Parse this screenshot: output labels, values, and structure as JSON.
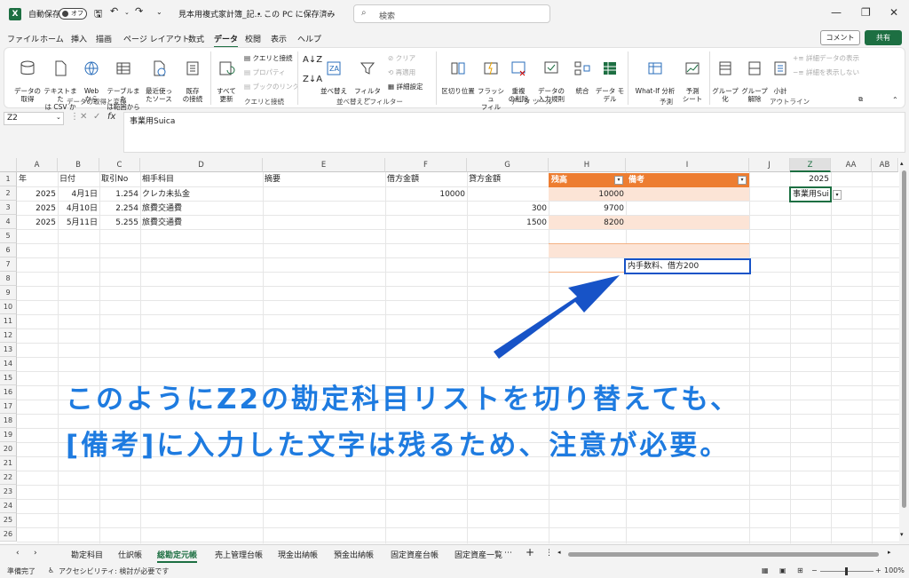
{
  "titlebar": {
    "autosave": "自動保存",
    "autosave_state": "オフ",
    "filename": "見本用複式家計簿_記…",
    "location": "• この PC に保存済み",
    "search_placeholder": "検索"
  },
  "menu": [
    "ファイル",
    "ホーム",
    "挿入",
    "描画",
    "ページ レイアウト",
    "数式",
    "データ",
    "校閲",
    "表示",
    "ヘルプ"
  ],
  "menu_active": "データ",
  "comment_label": "コメント",
  "share_label": "共有",
  "ribbon": {
    "get_data": "データの\n取得",
    "text_csv": "テキストまた\nは CSV から",
    "web": "Web\nから",
    "table_range": "テーブルまた\nは範囲から",
    "recent": "最近使っ\nたソース",
    "existing": "既存\nの接続",
    "group1": "データの取得と変換",
    "refresh_all": "すべて\n更新",
    "queries": "クエリと接続",
    "properties": "プロパティ",
    "edit_links": "ブックのリンク",
    "group2": "クエリと接続",
    "sort": "並べ替え",
    "filter": "フィルター",
    "clear": "クリア",
    "reapply": "再適用",
    "advanced": "詳細設定",
    "group3": "並べ替えとフィルター",
    "text_to_cols": "区切り位置",
    "flash_fill": "フラッシュ\nフィル",
    "remove_dup": "重複\nの削除",
    "validation": "データの\n入力規則",
    "consolidate": "統合",
    "data_model": "データ モ\nデル",
    "group4": "データ ツール",
    "whatif": "What-If 分析",
    "forecast": "予測\nシート",
    "group5": "予測",
    "group_btn": "グループ\n化",
    "ungroup": "グループ\n解除",
    "subtotal": "小計",
    "show_detail": "詳細データの表示",
    "hide_detail": "詳細を表示しない",
    "group6": "アウトライン"
  },
  "namebox": "Z2",
  "formula": "事業用Suica",
  "columns": [
    "A",
    "B",
    "C",
    "D",
    "E",
    "F",
    "G",
    "H",
    "I",
    "J",
    "Z",
    "AA",
    "AB"
  ],
  "rows": [
    "1",
    "2",
    "3",
    "4",
    "5",
    "6",
    "7",
    "8",
    "9",
    "10",
    "11",
    "12",
    "13",
    "14",
    "15",
    "16",
    "17",
    "18",
    "19",
    "20",
    "21",
    "22",
    "23",
    "24",
    "25",
    "26"
  ],
  "header_row": {
    "a": "年",
    "b": "日付",
    "c": "取引No",
    "d": "相手科目",
    "e": "摘要",
    "f": "借方金額",
    "g": "貸方金額",
    "h": "残高",
    "i": "備考",
    "z": "2025"
  },
  "data_rows": [
    {
      "a": "2025",
      "b": "4月1日",
      "c": "1.254",
      "d": "クレカ未払金",
      "f": "10000",
      "g": "",
      "h": "10000"
    },
    {
      "a": "2025",
      "b": "4月10日",
      "c": "2.254",
      "d": "旅費交通費",
      "f": "",
      "g": "300",
      "h": "9700"
    },
    {
      "a": "2025",
      "b": "5月11日",
      "c": "5.255",
      "d": "旅費交通費",
      "f": "",
      "g": "1500",
      "h": "8200"
    }
  ],
  "z2_value": "事業用Sui",
  "note_cell": "内手数料、借方200",
  "annotation": {
    "line1": "このようにZ2の勘定科目リストを切り替えても、",
    "line2": "[備考]に入力した文字は残るため、注意が必要。"
  },
  "sheet_tabs": [
    "勘定科目",
    "仕訳帳",
    "総勘定元帳",
    "売上管理台帳",
    "現金出納帳",
    "預金出納帳",
    "固定資産台帳",
    "固定資産一覧"
  ],
  "active_tab": "総勘定元帳",
  "status": {
    "ready": "準備完了",
    "accessibility": "アクセシビリティ: 検討が必要です",
    "zoom": "100%"
  },
  "colors": {
    "accent": "#1d6f42",
    "table_header": "#ed7d31",
    "band": "#fce4d6",
    "annotation": "#1e7be0",
    "arrow": "#1753c7"
  }
}
